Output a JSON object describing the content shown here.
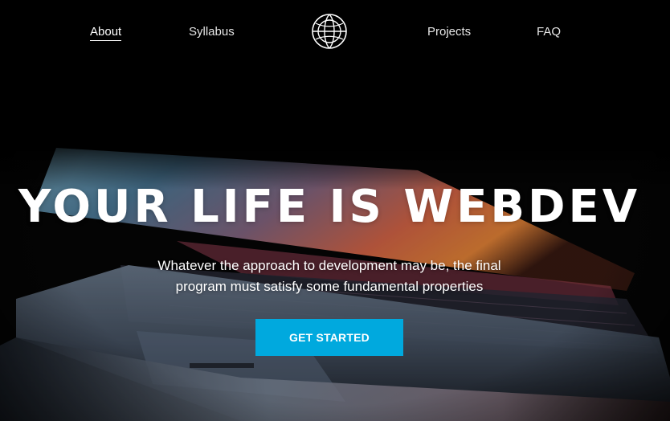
{
  "nav": {
    "links": [
      {
        "label": "About",
        "active": true
      },
      {
        "label": "Syllabus",
        "active": false
      },
      {
        "label": "Projects",
        "active": false
      },
      {
        "label": "FAQ",
        "active": false
      }
    ],
    "logo_icon": "globe-circle-icon"
  },
  "hero": {
    "headline": "YOUR LIFE IS WEBDEV",
    "subtitle_line1": "Whatever the approach to development may be, the final",
    "subtitle_line2": "program must satisfy some fundamental properties",
    "cta_label": "GET STARTED",
    "background_image": "laptop-half-open-dark-photo"
  },
  "colors": {
    "accent": "#00a9de",
    "background": "#050505",
    "text": "#ffffff"
  }
}
